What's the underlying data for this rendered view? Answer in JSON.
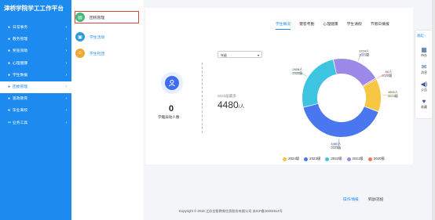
{
  "app": {
    "title": "津桥学院学工工作平台"
  },
  "sidebar": {
    "items": [
      {
        "label": "日常事务",
        "active": false
      },
      {
        "label": "教务管理",
        "active": false
      },
      {
        "label": "奖惩资助",
        "active": false
      },
      {
        "label": "心理健康",
        "active": false
      },
      {
        "label": "学生数据",
        "active": false
      },
      {
        "label": "团委管理",
        "active": true
      },
      {
        "label": "思政教育",
        "active": false
      },
      {
        "label": "毕业离校",
        "active": false
      },
      {
        "label": "业务工具",
        "active": false
      }
    ]
  },
  "submenu": {
    "items": [
      {
        "label": "团统管理",
        "icon": "book-icon",
        "color": "#43b97f",
        "selected": true
      },
      {
        "label": "学生活动",
        "icon": "monitor-icon",
        "color": "#2e9bd8",
        "selected": false
      },
      {
        "label": "学生社团",
        "icon": "face-icon",
        "color": "#f0a830",
        "selected": false
      }
    ]
  },
  "tabs": [
    {
      "label": "学生概况",
      "active": true
    },
    {
      "label": "键客考勤",
      "active": false
    },
    {
      "label": "心理健康",
      "active": false
    },
    {
      "label": "学生请假",
      "active": false
    },
    {
      "label": "节假日摘报",
      "active": false
    }
  ],
  "filter": {
    "value": "年级"
  },
  "stats": {
    "count": "0",
    "count_label": "学籍异动人数",
    "year_label": "2023届最多",
    "big_value": "4480",
    "big_unit": "/人"
  },
  "chart_data": {
    "type": "pie",
    "donut": true,
    "labels": [
      "2024级",
      "2023级",
      "2022级",
      "2021级",
      "2020级"
    ],
    "values": [
      1500,
      4480,
      2828,
      2224,
      60
    ],
    "colors": [
      "#f7c744",
      "#4a77f0",
      "#3cc4e0",
      "#9b88e8",
      "#f0775a"
    ],
    "callouts": [
      {
        "value": "1500人",
        "label": "2024级"
      },
      {
        "value": "4480人",
        "label": "2023级"
      },
      {
        "value": "2828人",
        "label": "2022级"
      },
      {
        "value": "2224人",
        "label": "2021级"
      },
      {
        "value": "60人",
        "label": "2020级"
      }
    ],
    "legend_position": "bottom"
  },
  "bottom_links": {
    "primary": "操作/填报",
    "secondary": "奖励/违纪"
  },
  "footer": {
    "copyright": "Copyright © 2018 江苏金智教育信息股份有限公司 苏ICP备10204514号"
  },
  "right_toolbar": {
    "collapse_label": "收起",
    "items": [
      {
        "label": "待办",
        "icon": "calendar-icon"
      },
      {
        "label": "消息",
        "icon": "mail-icon"
      },
      {
        "label": "公告",
        "icon": "speaker-icon"
      },
      {
        "label": "收藏",
        "icon": "heart-icon"
      }
    ]
  }
}
